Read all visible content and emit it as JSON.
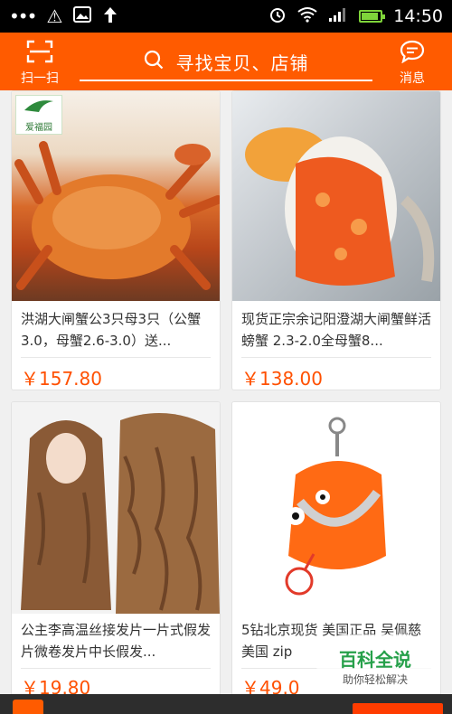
{
  "status_bar": {
    "time": "14:50"
  },
  "header": {
    "scan_label": "扫一扫",
    "search_placeholder": "寻找宝贝、店铺",
    "message_label": "消息"
  },
  "products": [
    {
      "title": "洪湖大闸蟹公3只母3只（公蟹3.0，母蟹2.6-3.0）送...",
      "price": "￥157.80",
      "image": "crab-orange-photo",
      "logo": "爱福园"
    },
    {
      "title": "现货正宗余记阳澄湖大闸蟹鲜活螃蟹 2.3-2.0全母蟹8...",
      "price": "￥138.00",
      "image": "crab-roe-photo"
    },
    {
      "title": "公主李高温丝接发片一片式假发片微卷发片中长假发...",
      "price": "￥19.80",
      "image": "curly-hair-photo"
    },
    {
      "title": "5钻北京现货 美国正品 吴佩慈 美国 zip",
      "price": "￥49.0",
      "image": "zipper-pouch-photo"
    }
  ],
  "watermark": {
    "title": "百科全说",
    "subtitle": "助你轻松解决"
  },
  "colors": {
    "brand": "#ff5b00",
    "price": "#ff5000"
  }
}
